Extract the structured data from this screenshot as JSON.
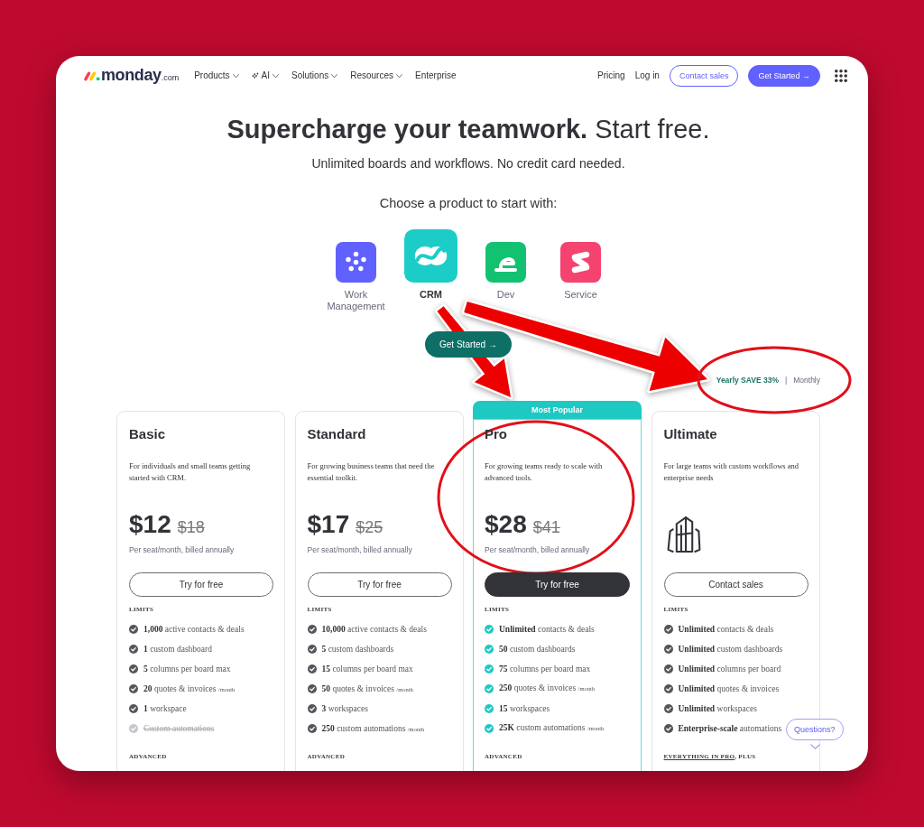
{
  "nav": {
    "logo": {
      "name": "monday",
      "suffix": ".com"
    },
    "menu": [
      {
        "label": "Products",
        "kind": "plain",
        "dropdown": true
      },
      {
        "label": "AI",
        "kind": "sparkle",
        "dropdown": true
      },
      {
        "label": "Solutions",
        "kind": "plain",
        "dropdown": true
      },
      {
        "label": "Resources",
        "kind": "plain",
        "dropdown": true
      },
      {
        "label": "Enterprise",
        "kind": "plain",
        "dropdown": false
      }
    ],
    "links": [
      "Pricing",
      "Log in"
    ],
    "buttons": [
      {
        "label": "Contact sales",
        "kind": "outline"
      },
      {
        "label": "Get Started →",
        "kind": "filled"
      }
    ]
  },
  "hero": {
    "title": "**Supercharge your teamwork.** Start free.",
    "subtitle": "Unlimited boards and workflows. No credit card needed.",
    "prompt": "Choose a product to start with:"
  },
  "products": [
    {
      "label": "Work Management",
      "color": "#6161ff",
      "selected": false
    },
    {
      "label": "CRM",
      "color": "#1ccdc7",
      "selected": true
    },
    {
      "label": "Dev",
      "color": "#12c271",
      "selected": false
    },
    {
      "label": "Service",
      "color": "#f4436e",
      "selected": false
    }
  ],
  "cta": "Get Started →",
  "billing": {
    "options": [
      {
        "label": "Yearly",
        "note": "SAVE 33%",
        "selected": true
      },
      {
        "label": "Monthly",
        "selected": false
      }
    ],
    "separator": "|"
  },
  "plans": [
    {
      "name": "Basic",
      "kind": "priced",
      "featured": false,
      "description": "For individuals and small teams getting started with CRM.",
      "price": "$12",
      "old_price": "$18",
      "price_note": "Per seat/month, billed annually",
      "button": "Try for free",
      "limits_heading": "LIMITS",
      "features": [
        {
          "text": "**1,000** active contacts & deals",
          "included": true
        },
        {
          "text": "**1** custom dashboard",
          "included": true
        },
        {
          "text": "**5** columns per board max",
          "included": true
        },
        {
          "text": "**20** quotes & invoices",
          "unit": "/month",
          "included": true
        },
        {
          "text": "**1** workspace",
          "included": true
        },
        {
          "text": "Custom automations",
          "included": false
        }
      ],
      "next_heading": {
        "text": "ADVANCED"
      }
    },
    {
      "name": "Standard",
      "kind": "priced",
      "featured": false,
      "description": "For growing business teams that need the essential toolkit.",
      "price": "$17",
      "old_price": "$25",
      "price_note": "Per seat/month, billed annually",
      "button": "Try for free",
      "limits_heading": "LIMITS",
      "features": [
        {
          "text": "**10,000** active contacts & deals",
          "included": true
        },
        {
          "text": "**5** custom dashboards",
          "included": true
        },
        {
          "text": "**15** columns per board max",
          "included": true
        },
        {
          "text": "**50** quotes & invoices",
          "unit": "/month",
          "included": true
        },
        {
          "text": "**3** workspaces",
          "included": true
        },
        {
          "text": "**250** custom automations",
          "unit": "/month",
          "included": true
        }
      ],
      "next_heading": {
        "text": "ADVANCED"
      }
    },
    {
      "name": "Pro",
      "kind": "priced",
      "featured": true,
      "badge": "Most Popular",
      "description": "For growing teams ready to scale with advanced tools.",
      "price": "$28",
      "old_price": "$41",
      "price_note": "Per seat/month, billed annually",
      "button": "Try for free",
      "limits_heading": "LIMITS",
      "features": [
        {
          "text": "**Unlimited** contacts & deals",
          "included": true
        },
        {
          "text": "**50** custom dashboards",
          "included": true
        },
        {
          "text": "**75** columns per board max",
          "included": true
        },
        {
          "text": "**250** quotes & invoices",
          "unit": "/month",
          "included": true
        },
        {
          "text": "**15** workspaces",
          "included": true
        },
        {
          "text": "**25K** custom automations",
          "unit": "/month",
          "included": true
        }
      ],
      "next_heading": {
        "text": "ADVANCED"
      }
    },
    {
      "name": "Ultimate",
      "kind": "enterprise",
      "featured": false,
      "description": "For large teams with custom workflows and enterprise needs",
      "button": "Contact sales",
      "limits_heading": "LIMITS",
      "features": [
        {
          "text": "**Unlimited** contacts & deals",
          "included": true
        },
        {
          "text": "**Unlimited** custom dashboards",
          "included": true
        },
        {
          "text": "**Unlimited** columns per board",
          "included": true
        },
        {
          "text": "**Unlimited** quotes & invoices",
          "included": true
        },
        {
          "text": "**Unlimited** workspaces",
          "included": true
        },
        {
          "text": "**Enterprise-scale** automations",
          "included": true
        }
      ],
      "next_heading": {
        "link": "EVERYTHING IN PRO",
        "text": ", PLUS"
      }
    }
  ],
  "help_button": "Questions?",
  "annotations": [
    {
      "kind": "arrow"
    },
    {
      "kind": "arrow"
    },
    {
      "kind": "ellipse"
    },
    {
      "kind": "ellipse"
    }
  ]
}
